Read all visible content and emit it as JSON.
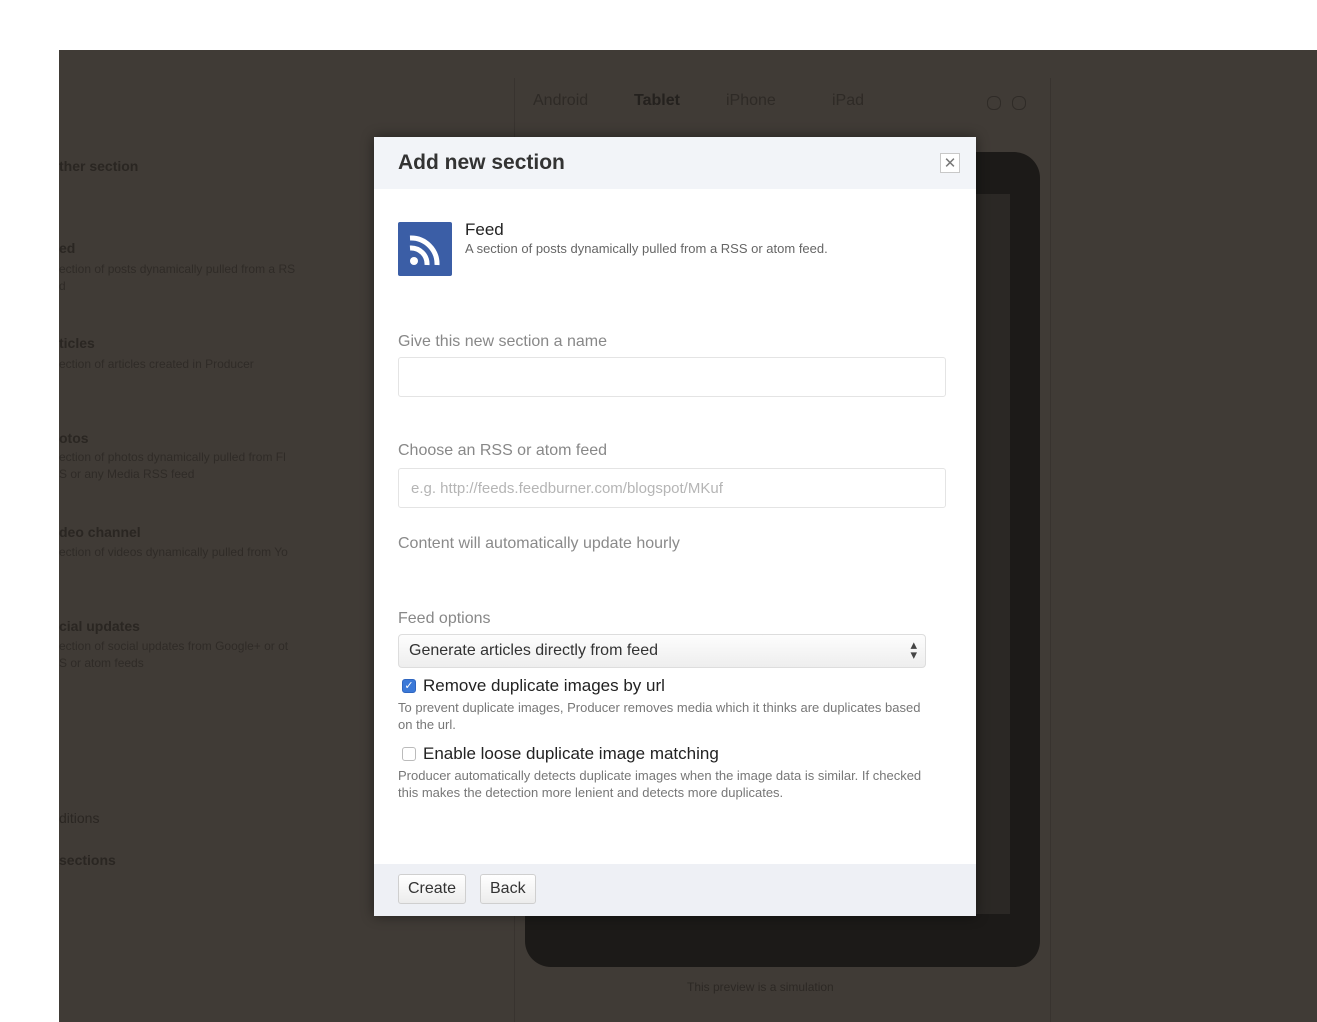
{
  "background": {
    "left_sections": [
      {
        "label": "ther section",
        "bold": true,
        "desc": ""
      },
      {
        "label": "ed",
        "bold": true,
        "desc": "ection of posts dynamically pulled from a RS\nd"
      },
      {
        "label": "ticles",
        "bold": true,
        "desc": "ection of articles created in Producer"
      },
      {
        "label": "otos",
        "bold": true,
        "desc": "ection of photos dynamically pulled from Fl\nS or any Media RSS feed"
      },
      {
        "label": "deo channel",
        "bold": true,
        "desc": "ection of videos dynamically pulled from Yo"
      },
      {
        "label": "cial updates",
        "bold": true,
        "desc": "ection of social updates from Google+ or ot\nS or atom feeds"
      }
    ],
    "bottom_items": [
      "ditions",
      "sections"
    ],
    "device_tabs": [
      {
        "label": "Android",
        "active": false
      },
      {
        "label": "Tablet",
        "active": true
      },
      {
        "label": "iPhone",
        "active": false
      },
      {
        "label": "iPad",
        "active": false
      }
    ],
    "preview_note": "This preview is a simulation"
  },
  "modal": {
    "title": "Add new section",
    "close_symbol": "✕",
    "section_type": {
      "icon": "rss-feed-icon",
      "title": "Feed",
      "description": "A section of posts dynamically pulled from a RSS or atom feed."
    },
    "name_field": {
      "label": "Give this new section a name",
      "value": "",
      "placeholder": ""
    },
    "feed_field": {
      "label": "Choose an RSS or atom feed",
      "value": "",
      "placeholder": "e.g. http://feeds.feedburner.com/blogspot/MKuf"
    },
    "update_hint": "Content will automatically update hourly",
    "feed_options": {
      "label": "Feed options",
      "selected": "Generate articles directly from feed"
    },
    "remove_duplicates": {
      "checked": true,
      "label": "Remove duplicate images by url",
      "help": "To prevent duplicate images, Producer removes media which it thinks are duplicates based on the url."
    },
    "loose_matching": {
      "checked": false,
      "label": "Enable loose duplicate image matching",
      "help": "Producer automatically detects duplicate images when the image data is similar. If checked this makes the detection more lenient and detects more duplicates."
    },
    "buttons": {
      "create": "Create",
      "back": "Back"
    }
  },
  "colors": {
    "accent": "#3b5ea6",
    "checkbox_checked": "#3b79d8",
    "overlay": "#403b36"
  }
}
